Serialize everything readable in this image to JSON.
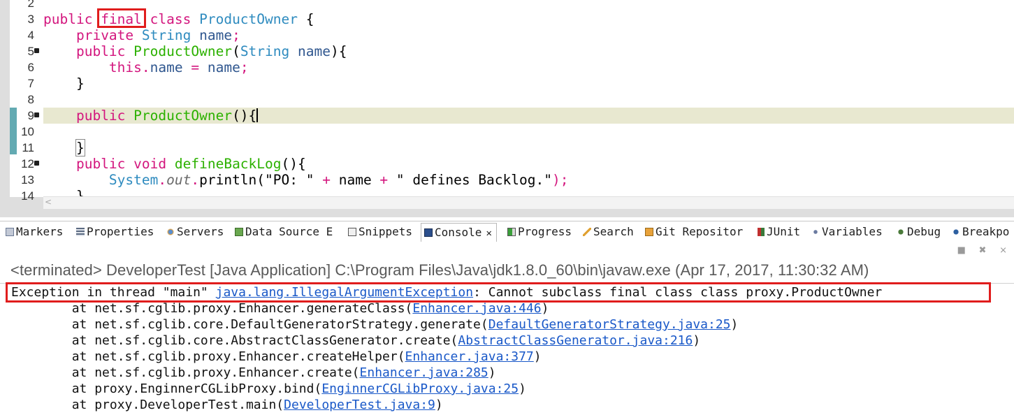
{
  "editor": {
    "line_numbers": [
      "2",
      "3",
      "4",
      "5",
      "6",
      "7",
      "8",
      "9",
      "10",
      "11",
      "12",
      "13",
      "14"
    ],
    "code": {
      "l3": {
        "public": "public",
        "final": "final",
        "class": "class",
        "name": "ProductOwner",
        "brace": "{"
      },
      "l4": {
        "private": "private",
        "type": "String",
        "field": "name",
        "semi": ";"
      },
      "l5": {
        "public": "public",
        "ctor": "ProductOwner",
        "open": "(",
        "type": "String",
        "param": "name",
        "close": "){"
      },
      "l6": {
        "this": "this",
        "dot": ".",
        "field": "name",
        "eq": " = ",
        "value": "name",
        "semi": ";"
      },
      "l7": {
        "brace": "}"
      },
      "l9": {
        "public": "public",
        "ctor": "ProductOwner",
        "parens": "(){"
      },
      "l11": {
        "brace": "}"
      },
      "l12": {
        "public": "public",
        "void": "void",
        "method": "defineBackLog",
        "parens": "(){"
      },
      "l13": {
        "system": "System",
        "dot1": ".",
        "out": "out",
        "dot2": ".",
        "println": "println(",
        "s1": "\"PO: \"",
        "plus1": " + ",
        "name": "name",
        "plus2": " + ",
        "s2": "\" defines Backlog.\"",
        "end": ");"
      },
      "l14": {
        "brace": "}"
      }
    },
    "scroll_left_icon": "chevron-left-icon"
  },
  "views": {
    "tabs": [
      {
        "label": "Markers",
        "icon": "markers-icon"
      },
      {
        "label": "Properties",
        "icon": "properties-icon"
      },
      {
        "label": "Servers",
        "icon": "servers-icon"
      },
      {
        "label": "Data Source E",
        "icon": "data-source-icon"
      },
      {
        "label": "Snippets",
        "icon": "snippets-icon"
      },
      {
        "label": "Console",
        "icon": "console-icon",
        "close": "✕"
      },
      {
        "label": "Progress",
        "icon": "progress-icon"
      },
      {
        "label": "Search",
        "icon": "search-icon"
      },
      {
        "label": "Git Repositor",
        "icon": "git-icon"
      },
      {
        "label": "JUnit",
        "icon": "junit-icon"
      },
      {
        "label": "Variables",
        "icon": "variables-icon"
      },
      {
        "label": "Debug",
        "icon": "debug-icon"
      },
      {
        "label": "Breakpo",
        "icon": "breakpoints-icon"
      }
    ],
    "toolbar": [
      {
        "name": "terminate-icon",
        "glyph": "■"
      },
      {
        "name": "remove-launch-icon",
        "glyph": "✖"
      },
      {
        "name": "remove-all-launches-icon",
        "glyph": "⨯"
      }
    ]
  },
  "console": {
    "status": "<terminated> DeveloperTest [Java Application] C:\\Program Files\\Java\\jdk1.8.0_60\\bin\\javaw.exe (Apr 17, 2017, 11:30:32 AM)",
    "exception": {
      "prefix": "Exception in thread \"main\" ",
      "link": "java.lang.IllegalArgumentException",
      "message": ": Cannot subclass final class class proxy.ProductOwner"
    },
    "stack": [
      {
        "text": "\tat net.sf.cglib.proxy.Enhancer.generateClass(",
        "link": "Enhancer.java:446",
        "end": ")"
      },
      {
        "text": "\tat net.sf.cglib.core.DefaultGeneratorStrategy.generate(",
        "link": "DefaultGeneratorStrategy.java:25",
        "end": ")"
      },
      {
        "text": "\tat net.sf.cglib.core.AbstractClassGenerator.create(",
        "link": "AbstractClassGenerator.java:216",
        "end": ")"
      },
      {
        "text": "\tat net.sf.cglib.proxy.Enhancer.createHelper(",
        "link": "Enhancer.java:377",
        "end": ")"
      },
      {
        "text": "\tat net.sf.cglib.proxy.Enhancer.create(",
        "link": "Enhancer.java:285",
        "end": ")"
      },
      {
        "text": "\tat proxy.EnginnerCGLibProxy.bind(",
        "link": "EnginnerCGLibProxy.java:25",
        "end": ")"
      },
      {
        "text": "\tat proxy.DeveloperTest.main(",
        "link": "DeveloperTest.java:9",
        "end": ")"
      }
    ]
  },
  "colors": {
    "highlight_box": "#e01d1d",
    "keyword": "#d3167e",
    "type": "#2e8bbf",
    "method": "#2cb100",
    "link": "#1958c8"
  }
}
